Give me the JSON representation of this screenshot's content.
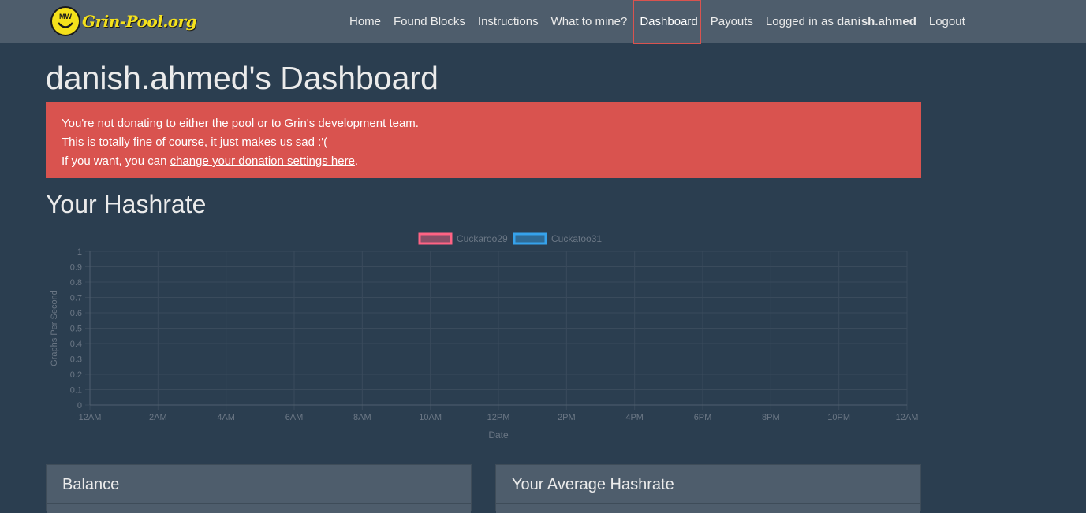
{
  "brand": {
    "name": "Grin-Pool.org",
    "logo_text": "MW"
  },
  "nav": {
    "home": "Home",
    "found_blocks": "Found Blocks",
    "instructions": "Instructions",
    "what_to_mine": "What to mine?",
    "dashboard": "Dashboard",
    "payouts": "Payouts",
    "logged_in_prefix": "Logged in as ",
    "username": "danish.ahmed",
    "logout": "Logout"
  },
  "page": {
    "title": "danish.ahmed's Dashboard"
  },
  "alert": {
    "line1": "You're not donating to either the pool or to Grin's development team.",
    "line2": "This is totally fine of course, it just makes us sad :'(",
    "line3_prefix": "If you want, you can ",
    "line3_link": "change your donation settings here",
    "line3_suffix": "."
  },
  "hashrate_section": {
    "title": "Your Hashrate"
  },
  "chart_data": {
    "type": "line",
    "x": [
      "12AM",
      "2AM",
      "4AM",
      "6AM",
      "8AM",
      "10AM",
      "12PM",
      "2PM",
      "4PM",
      "6PM",
      "8PM",
      "10PM",
      "12AM"
    ],
    "series": [
      {
        "name": "Cuckaroo29",
        "values": [],
        "color": "#ff6384"
      },
      {
        "name": "Cuckatoo31",
        "values": [],
        "color": "#36a2eb"
      }
    ],
    "xlabel": "Date",
    "ylabel": "Graphs Per Second",
    "ylim": [
      0,
      1
    ],
    "yticks": [
      "0",
      "0.1",
      "0.2",
      "0.3",
      "0.4",
      "0.5",
      "0.6",
      "0.7",
      "0.8",
      "0.9",
      "1"
    ],
    "grid": true,
    "legend": "top-center"
  },
  "panels": {
    "balance": "Balance",
    "average_hashrate": "Your Average Hashrate"
  },
  "colors": {
    "background": "#2b3e50",
    "navbar": "#4e5d6c",
    "alert": "#d9534f",
    "brand_yellow": "#f5e11b"
  }
}
